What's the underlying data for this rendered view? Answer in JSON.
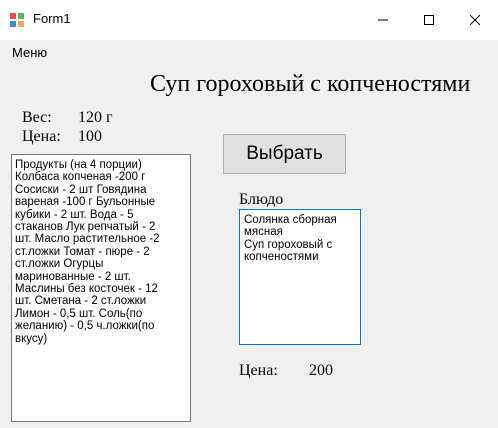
{
  "window": {
    "title": "Form1"
  },
  "menu": {
    "items": [
      "Меню"
    ]
  },
  "main": {
    "dish_title": "Суп гороховый с копченостями",
    "weight_label": "Вес:",
    "weight_value": "120 г",
    "price_label": "Цена:",
    "price_value": "100",
    "select_button": "Выбрать",
    "ingredients_text": "Продукты (на 4 порции)\nКолбаса копченая -200 г\nСосиски - 2 шт Говядина\nвареная -100 г Бульонные\nкубики - 2 шт. Вода - 5\nстаканов Лук репчатый - 2\nшт.  Масло растительное -2\nст.ложки Томат - пюре - 2\nст.ложки  Огурцы\nмаринованные - 2 шт.\nМаслины без косточек - 12\nшт. Сметана - 2 ст.ложки\nЛимон - 0,5 шт. Соль(по\nжеланию) - 0,5 ч.ложки(по\nвкусу)",
    "dish_label": "Блюдо",
    "dishes": [
      "Солянка сборная мясная",
      "Суп гороховый с копченостями"
    ],
    "bottom_price_label": "Цена:",
    "bottom_price_value": "200"
  },
  "icons": {
    "app": "winforms-app-icon",
    "minimize": "minimize-icon",
    "maximize": "maximize-icon",
    "close": "close-icon"
  }
}
